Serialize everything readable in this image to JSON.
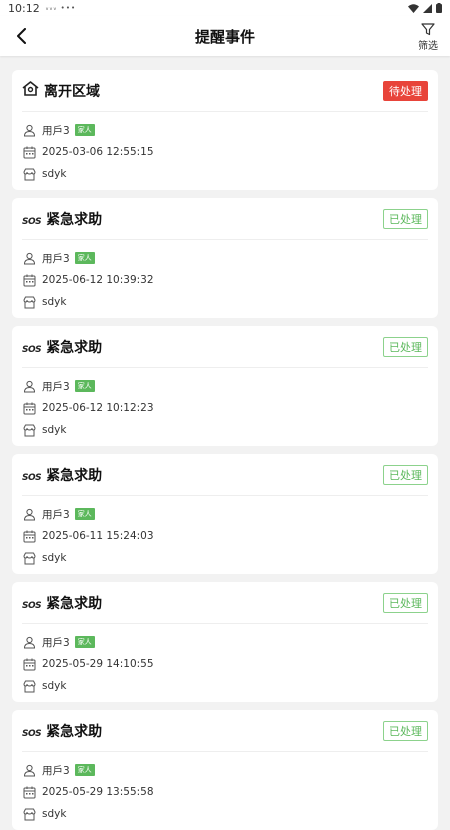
{
  "status_bar": {
    "time": "10:12",
    "extra": "ᵥᵥᵥ •••"
  },
  "header": {
    "title": "提醒事件",
    "filter_label": "筛选"
  },
  "events": [
    {
      "icon": "home-icon",
      "title": "离开区域",
      "status": "待处理",
      "status_type": "pending",
      "user": "用戶3",
      "tag": "家人",
      "datetime": "2025-03-06 12:55:15",
      "location": "sdyk"
    },
    {
      "icon": "sos-icon",
      "title": "紧急求助",
      "status": "已处理",
      "status_type": "done",
      "user": "用戶3",
      "tag": "家人",
      "datetime": "2025-06-12 10:39:32",
      "location": "sdyk"
    },
    {
      "icon": "sos-icon",
      "title": "紧急求助",
      "status": "已处理",
      "status_type": "done",
      "user": "用戶3",
      "tag": "家人",
      "datetime": "2025-06-12 10:12:23",
      "location": "sdyk"
    },
    {
      "icon": "sos-icon",
      "title": "紧急求助",
      "status": "已处理",
      "status_type": "done",
      "user": "用戶3",
      "tag": "家人",
      "datetime": "2025-06-11 15:24:03",
      "location": "sdyk"
    },
    {
      "icon": "sos-icon",
      "title": "紧急求助",
      "status": "已处理",
      "status_type": "done",
      "user": "用戶3",
      "tag": "家人",
      "datetime": "2025-05-29 14:10:55",
      "location": "sdyk"
    },
    {
      "icon": "sos-icon",
      "title": "紧急求助",
      "status": "已处理",
      "status_type": "done",
      "user": "用戶3",
      "tag": "家人",
      "datetime": "2025-05-29 13:55:58",
      "location": "sdyk"
    }
  ],
  "sos_text": "SOS",
  "colors": {
    "pending": "#e8443a",
    "done": "#5cb85c",
    "tag": "#5cb85c"
  }
}
